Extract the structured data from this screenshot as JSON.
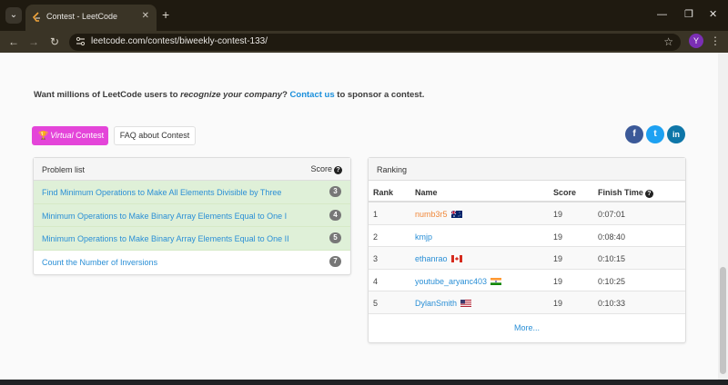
{
  "browser": {
    "tab_title": "Contest - LeetCode",
    "url": "leetcode.com/contest/biweekly-contest-133/",
    "profile_initial": "Y"
  },
  "page": {
    "sponsor": {
      "prefix": "Want millions of LeetCode users to ",
      "emphasis": "recognize your company",
      "middle": "? ",
      "link": "Contact us",
      "suffix": " to sponsor a contest."
    },
    "buttons": {
      "virtual_italic": "Virtual",
      "virtual_rest": " Contest",
      "faq": "FAQ about Contest"
    },
    "social": {
      "facebook": "f",
      "twitter": "t",
      "linkedin": "in"
    },
    "problem_list": {
      "title": "Problem list",
      "score_header": "Score",
      "help_glyph": "?",
      "items": [
        {
          "name": "Find Minimum Operations to Make All Elements Divisible by Three",
          "score": "3"
        },
        {
          "name": "Minimum Operations to Make Binary Array Elements Equal to One I",
          "score": "4"
        },
        {
          "name": "Minimum Operations to Make Binary Array Elements Equal to One II",
          "score": "5"
        },
        {
          "name": "Count the Number of Inversions",
          "score": "7"
        }
      ]
    },
    "ranking": {
      "title": "Ranking",
      "headers": {
        "rank": "Rank",
        "name": "Name",
        "score": "Score",
        "finish_time": "Finish Time"
      },
      "rows": [
        {
          "rank": "1",
          "name": "numb3r5",
          "score": "19",
          "time": "0:07:01"
        },
        {
          "rank": "2",
          "name": "kmjp",
          "score": "19",
          "time": "0:08:40"
        },
        {
          "rank": "3",
          "name": "ethanrao",
          "score": "19",
          "time": "0:10:15"
        },
        {
          "rank": "4",
          "name": "youtube_aryanc403",
          "score": "19",
          "time": "0:10:25"
        },
        {
          "rank": "5",
          "name": "DylanSmith",
          "score": "19",
          "time": "0:10:33"
        }
      ],
      "more": "More..."
    }
  }
}
